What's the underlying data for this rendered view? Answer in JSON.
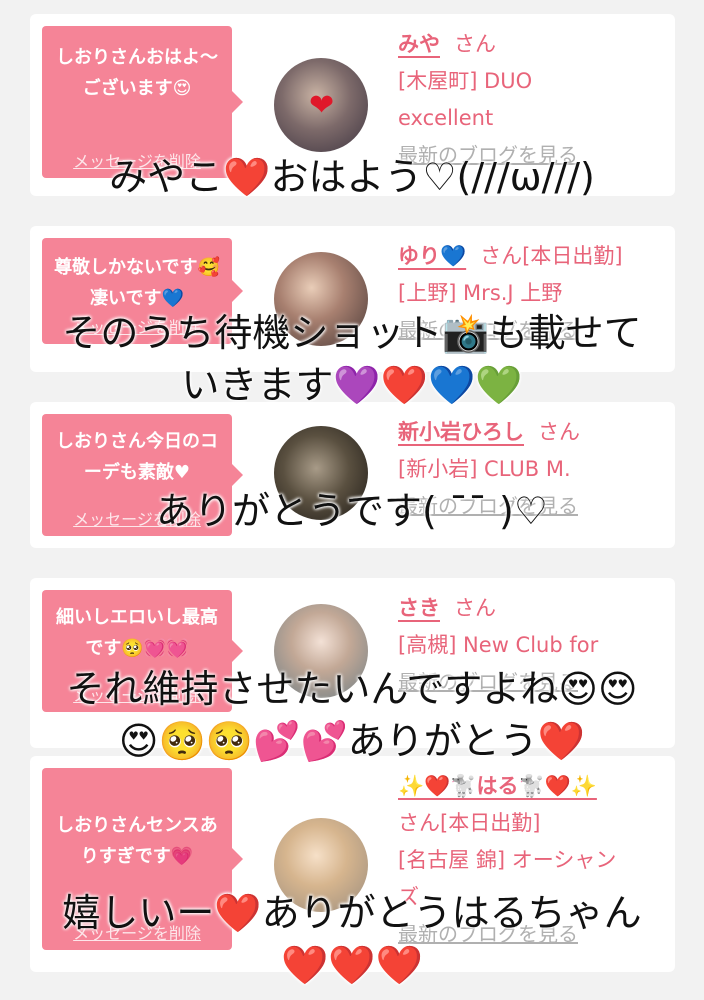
{
  "cards": [
    {
      "message": "しおりさんおはよ〜ございます😍",
      "delete_label": "メッセージを削除",
      "name": "みや",
      "san": "さん",
      "shop_lines": [
        "[木屋町] DUO",
        "excellent"
      ],
      "blog_label": "最新のブログを見る"
    },
    {
      "message": "尊敬しかないです🥰凄いです💙",
      "delete_label": "メッセージを削除",
      "name": "ゆり💙",
      "san": "さん[本日出勤]",
      "shop_lines": [
        "[上野] Mrs.J 上野"
      ],
      "blog_label": "最新のブログを見る"
    },
    {
      "message": "しおりさん今日のコーデも素敵♥",
      "delete_label": "メッセージを削除",
      "name": "新小岩ひろし",
      "san": "さん",
      "shop_lines": [
        "[新小岩] CLUB M."
      ],
      "blog_label": "最新のブログを見る"
    },
    {
      "message": "細いしエロいし最高です🥺💓💓",
      "delete_label": "メッセージを削除",
      "name": "さき",
      "san": "さん",
      "shop_lines": [
        "[高槻] New Club for"
      ],
      "blog_label": "最新のブログを見る"
    },
    {
      "message": "しおりさんセンスありすぎです💗",
      "delete_label": "メッセージを削除",
      "name": "✨❤️🐩はる🐩❤️✨",
      "san": "さん[本日出勤]",
      "shop_lines": [
        "[名古屋 錦] オーシャン",
        "ズ"
      ],
      "blog_label": "最新のブログを見る"
    }
  ],
  "captions": {
    "c1": "みやこ❤️おはよう♡(///ω///)",
    "c2a": "そのうち待機ショット📸も載せて",
    "c2b": "いきます💜❤️💙💚",
    "c3": "ありがとうです(  ¯¯ )♡",
    "c4a": "それ維持させたいんですよね😍😍",
    "c4b": "😍🥺🥺💕💕ありがとう❤️",
    "c5a": "嬉しいー❤️ありがとうはるちゃん",
    "c5b": "❤️❤️❤️"
  },
  "colors": {
    "bubble": "#f58497",
    "name": "#e8647a",
    "background": "#f2f2f2"
  }
}
